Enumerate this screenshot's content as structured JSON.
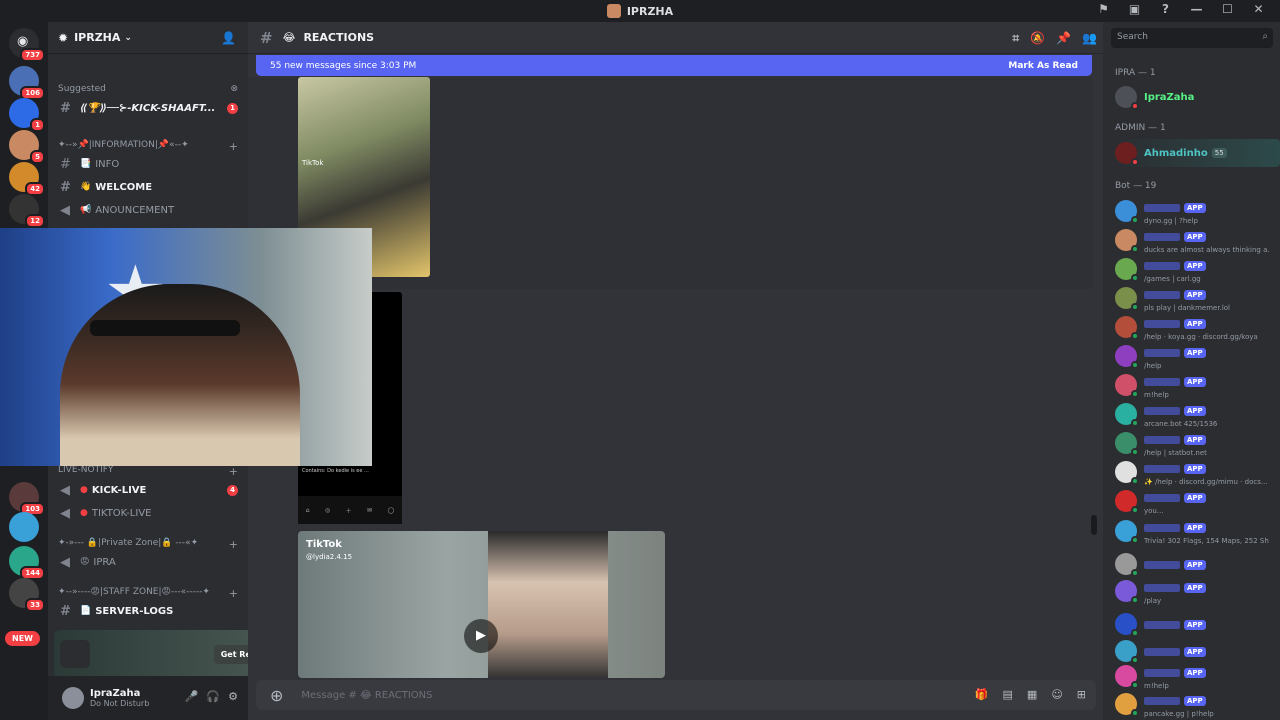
{
  "window": {
    "title": "IPRZHA"
  },
  "servers": {
    "home_badge": "737",
    "badges": [
      "106",
      "1",
      "5",
      "42",
      "12",
      "103",
      "144",
      "33"
    ],
    "new_label": "NEW"
  },
  "server": {
    "name": "IPRZHA"
  },
  "channels": {
    "suggested_label": "Suggested",
    "suggested_channel": "⟪🏆⟫──⊱-KICK-SHAAFT...",
    "suggested_badge": "1",
    "info_category": "✦--»📌|INFORMATION|📌«--✦",
    "items": [
      {
        "emoji": "📑",
        "name": "INFO"
      },
      {
        "emoji": "👋",
        "name": "WELCOME"
      },
      {
        "emoji": "📢",
        "name": "ANOUNCEMENT"
      }
    ],
    "live_category": "LIVE-NOTIFY",
    "live_items": [
      {
        "name": "KICK-LIVE",
        "badge": "4"
      },
      {
        "name": "TIKTOK-LIVE"
      }
    ],
    "private_category": "✦-»--- 🔒|Private Zone|🔒 ---«✦",
    "private_item": "IPRA",
    "staff_category": "✦--»----😡|STAFF ZONE|😡---«-----✦",
    "staff_item": "SERVER-LOGS"
  },
  "promo": {
    "button": "Get Reward!"
  },
  "user": {
    "name": "IpraZaha",
    "status": "Do Not Disturb"
  },
  "channel_header": {
    "emoji": "😂",
    "name": "REACTIONS"
  },
  "new_messages": {
    "text": "55 new messages since 3:03 PM",
    "action": "Mark As Read"
  },
  "media": {
    "tiktok_small": "TikTok",
    "caption": "Contains: Do kedie is ee ...",
    "video_brand": "TikTok",
    "video_user": "@lydia2.4.15"
  },
  "composer": {
    "placeholder": "Message #  😂  REACTIONS"
  },
  "search": {
    "placeholder": "Search"
  },
  "members": {
    "ipra_category": "IPRA — 1",
    "ipra_user": "IpraZaha",
    "admin_category": "ADMIN — 1",
    "admin_user": "Ahmadinho",
    "admin_tag": "55",
    "bot_category": "Bot — 19",
    "app_label": "APP",
    "bots": [
      {
        "status": "dyno.gg | ?help"
      },
      {
        "status": "ducks are almost always thinking a..."
      },
      {
        "status": "/games | carl.gg"
      },
      {
        "status": "pls play | dankmemer.lol"
      },
      {
        "status": "/help · koya.gg · discord.gg/koya"
      },
      {
        "status": "/help"
      },
      {
        "status": "m!help"
      },
      {
        "status": "arcane.bot 425/1536"
      },
      {
        "status": "/help | statbot.net"
      },
      {
        "status": "✨ /help · discord.gg/mimu · docs..."
      },
      {
        "status": "you..."
      },
      {
        "status": "Trivia! 302 Flags, 154 Maps, 252 Shap"
      },
      {
        "status": ""
      },
      {
        "status": "/play"
      },
      {
        "status": ""
      },
      {
        "status": ""
      },
      {
        "status": "m!help"
      },
      {
        "status": "pancake.gg | p!help"
      }
    ]
  },
  "colors": {
    "accent": "#5865f2",
    "danger": "#f23f43",
    "online": "#23a55a",
    "admin": "#4ec3c3"
  }
}
